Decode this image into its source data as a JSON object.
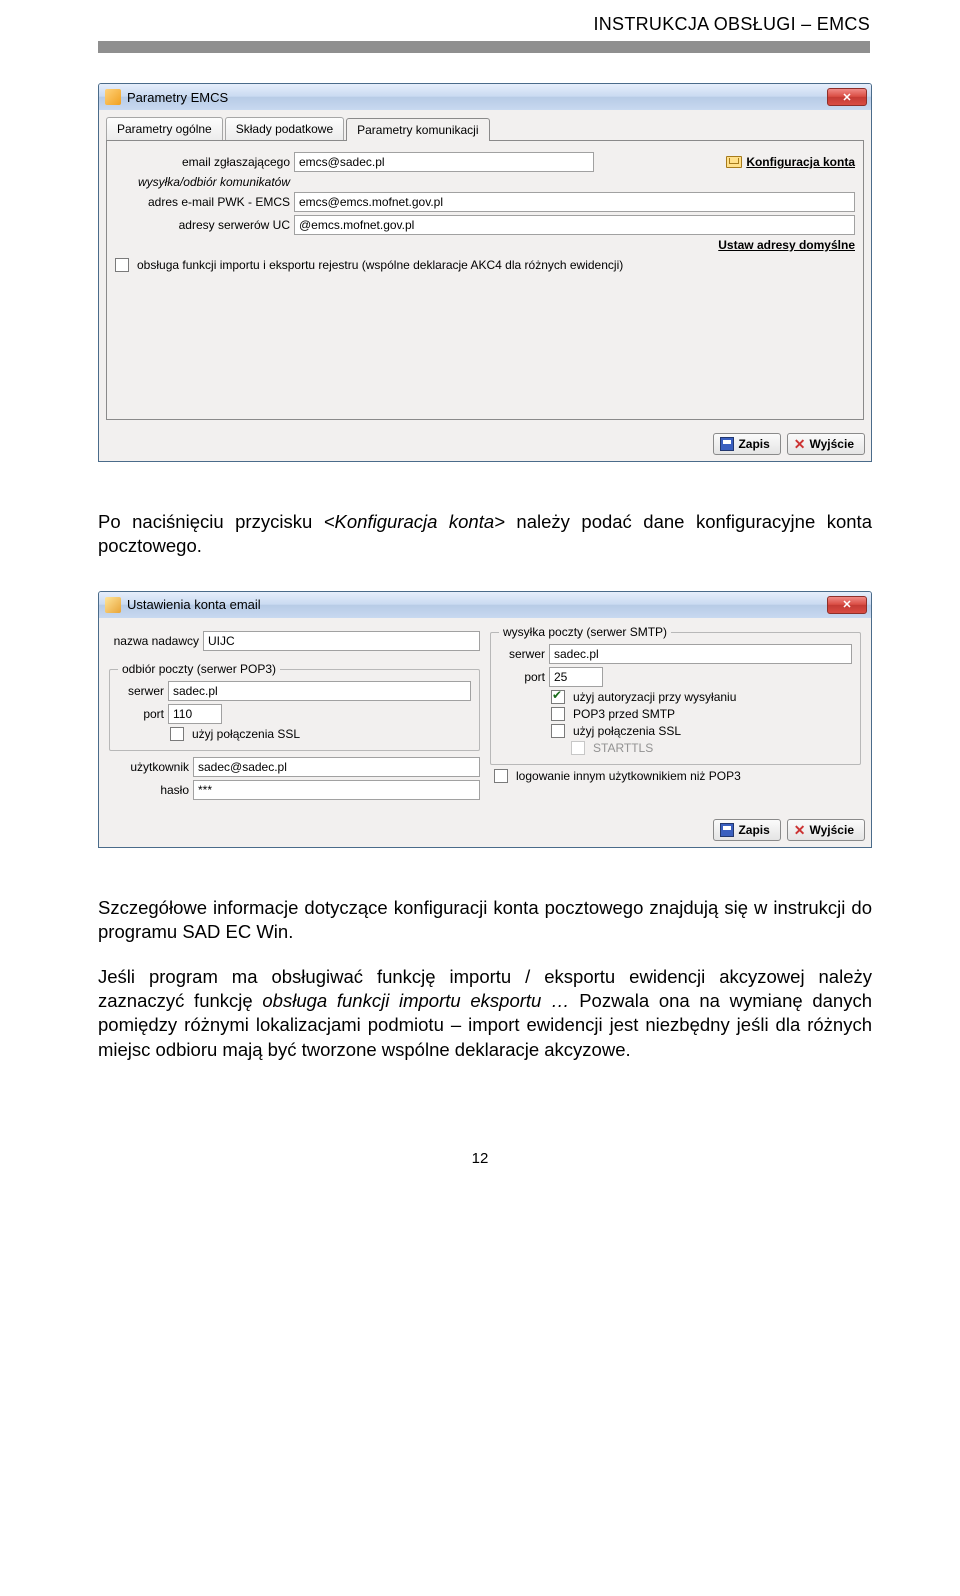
{
  "header": {
    "title": "INSTRUKCJA OBSŁUGI – EMCS"
  },
  "body": {
    "p1_prefix": "Po naciśnięciu przycisku ",
    "p1_em": "<Konfiguracja konta>",
    "p1_suffix": " należy podać dane konfiguracyjne konta pocztowego.",
    "p2": "Szczegółowe informacje dotyczące konfiguracji konta pocztowego znajdują się w instrukcji do programu SAD EC Win.",
    "p3_prefix": "Jeśli program ma obsługiwać funkcję importu / eksportu ewidencji akcyzowej należy zaznaczyć funkcję ",
    "p3_em": "obsługa funkcji importu eksportu …",
    "p3_suffix": " Pozwala ona na wymianę danych pomiędzy różnymi lokalizacjami podmiotu – import ewidencji jest niezbędny jeśli dla różnych miejsc odbioru mają być tworzone wspólne deklaracje akcyzowe."
  },
  "d1": {
    "title": "Parametry EMCS",
    "tabs": {
      "t1": "Parametry ogólne",
      "t2": "Składy podatkowe",
      "t3": "Parametry komunikacji"
    },
    "labels": {
      "email": "email zgłaszającego",
      "sec_header": "wysyłka/odbiór komunikatów",
      "pwk": "adres e-mail PWK - EMCS",
      "uc": "adresy serwerów UC",
      "konf": "Konfiguracja konta",
      "defaults": "Ustaw adresy domyślne",
      "chk_import": "obsługa funkcji importu i eksportu rejestru (wspólne deklaracje AKC4 dla różnych ewidencji)"
    },
    "values": {
      "email": "emcs@sadec.pl",
      "pwk": "emcs@emcs.mofnet.gov.pl",
      "uc": "@emcs.mofnet.gov.pl"
    },
    "btn_save": "Zapis",
    "btn_exit": "Wyjście"
  },
  "d2": {
    "title": "Ustawienia konta email",
    "labels": {
      "nazwa": "nazwa nadawcy",
      "pop3_group": "odbiór poczty (serwer POP3)",
      "smtp_group": "wysyłka poczty (serwer SMTP)",
      "serwer": "serwer",
      "port": "port",
      "ssl": "użyj połączenia SSL",
      "starttls": "STARTTLS",
      "auth_send": "użyj autoryzacji przy wysyłaniu",
      "pop3_first": "POP3 przed SMTP",
      "other_login": "logowanie innym użytkownikiem niż POP3",
      "user": "użytkownik",
      "pass": "hasło"
    },
    "values": {
      "nazwa": "UIJC",
      "pop3_serwer": "sadec.pl",
      "pop3_port": "110",
      "smtp_serwer": "sadec.pl",
      "smtp_port": "25",
      "user": "sadec@sadec.pl",
      "pass": "***"
    },
    "btn_save": "Zapis",
    "btn_exit": "Wyjście"
  },
  "page_num": "12"
}
